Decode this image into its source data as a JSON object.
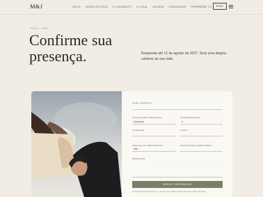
{
  "header": {
    "logo": "M&J",
    "nav": [
      "INÍCIO",
      "NOSSA HISTÓRIA",
      "O CASAMENTO",
      "O LOCAL",
      "GALERIA",
      "CONVIDADOS",
      "PRESENTES"
    ],
    "langs": [
      "PT",
      "EN",
      "ES"
    ],
    "rsvp_label": "RSVP"
  },
  "breadcrumb": "INÍCIO — RSVP",
  "hero": {
    "title": "Confirme sua presença.",
    "text": "Responda até 12 de agosto de 2027. Será uma alegria celebrar ao seu lado."
  },
  "form": {
    "name_label": "NOME COMPLETO",
    "attendance_label": "VOCÊ ESTARÁ PRESENTE?",
    "attendance_value": "Selecione",
    "companions_label": "ACOMPANHANTES",
    "companions_value": "0",
    "phone_label": "TELEFONE",
    "email_label": "E-MAIL",
    "transport_label": "PRECISA DE TRANSPORTE?",
    "transport_value": "Não",
    "dietary_label": "RESTRIÇÕES ALIMENTARES",
    "message_label": "MENSAGEM",
    "submit_label": "ENVIAR CONFIRMAÇÃO",
    "privacy_text": "Ao enviar, você concorda com o uso dos seus dados apenas para este evento. Obrigado."
  }
}
